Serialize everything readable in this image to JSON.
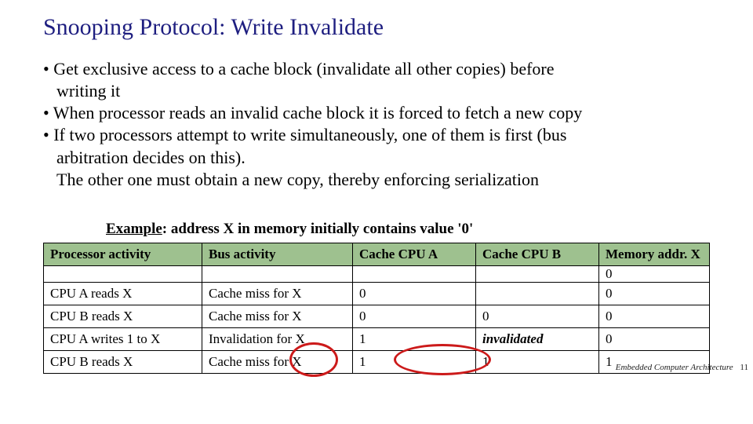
{
  "title": "Snooping Protocol: Write Invalidate",
  "bullets": {
    "b1a": "• Get exclusive access to a cache block (invalidate all other copies) before",
    "b1b": "writing it",
    "b2": "• When processor reads an invalid cache block it is forced to fetch a new copy",
    "b3a": "• If two processors attempt to write simultaneously, one of them is first (bus",
    "b3b": "arbitration decides on this).",
    "b3c": "The other one must obtain a new copy, thereby enforcing serialization"
  },
  "example": {
    "label_underlined": "Example",
    "label_rest": ": address X in memory initially contains value '0'"
  },
  "table": {
    "headers": {
      "c1": "Processor activity",
      "c2": "Bus activity",
      "c3": "Cache CPU A",
      "c4": "Cache CPU B",
      "c5": "Memory addr. X"
    },
    "rows": [
      {
        "c1": "",
        "c2": "",
        "c3": "",
        "c4": "",
        "c5": "0"
      },
      {
        "c1": "CPU A reads X",
        "c2": "Cache miss for X",
        "c3": "0",
        "c4": "",
        "c5": "0"
      },
      {
        "c1": "CPU B reads X",
        "c2": "Cache miss for X",
        "c3": "0",
        "c4": "0",
        "c5": "0"
      },
      {
        "c1": "CPU A writes 1 to X",
        "c2": "Invalidation for X",
        "c3": "1",
        "c4": "invalidated",
        "c5": "0"
      },
      {
        "c1": "CPU B reads X",
        "c2": "Cache miss for X",
        "c3": "1",
        "c4": "1",
        "c5": "1"
      }
    ]
  },
  "footer": {
    "text": "Embedded Computer Architecture",
    "page": "11"
  }
}
